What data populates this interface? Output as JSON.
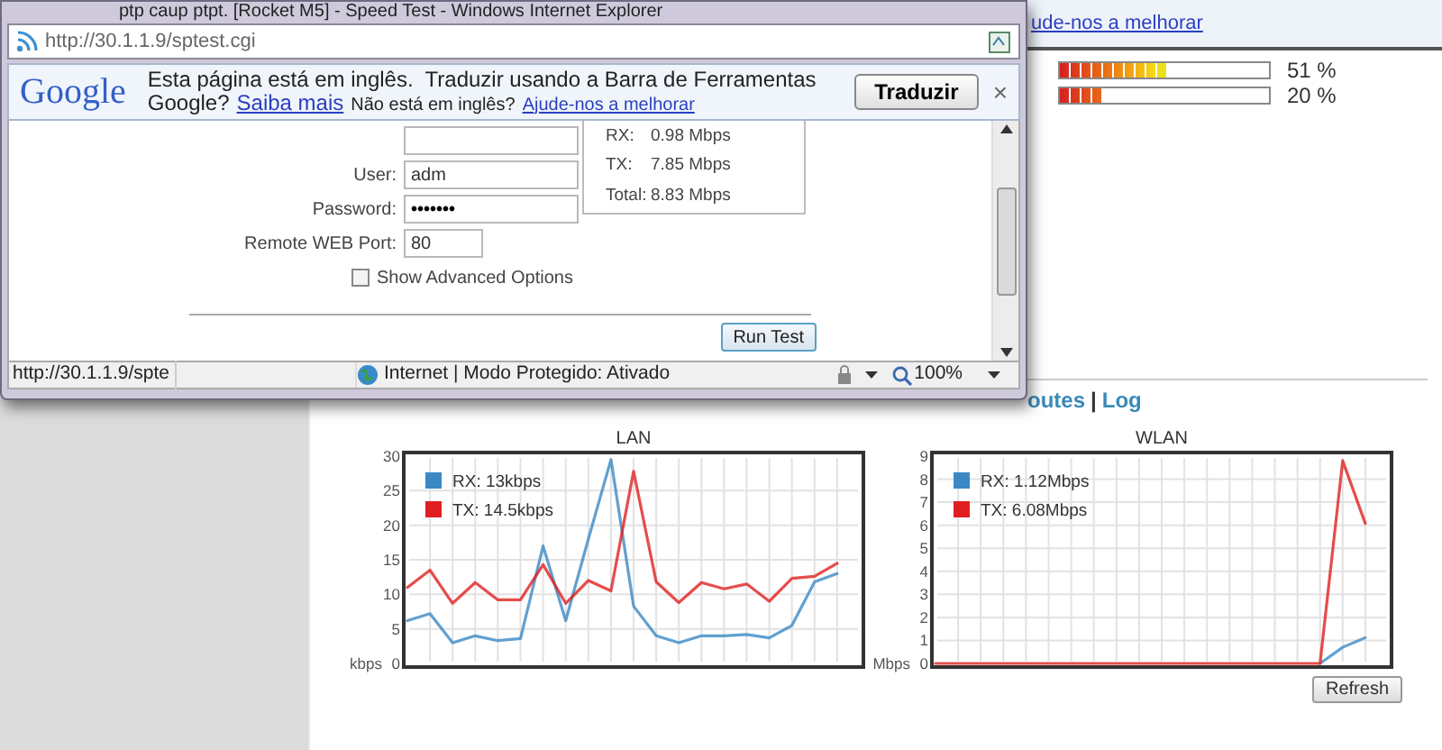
{
  "page": {
    "translate_link": "ude-nos a melhorar",
    "meters": [
      {
        "level": 0.51,
        "reading": "51 %"
      },
      {
        "level": 0.2,
        "reading": "20 %"
      }
    ],
    "links": [
      "outes",
      "Log"
    ],
    "link_separator": "|",
    "charts": [
      {
        "chart_data": {
          "type": "line",
          "title": "LAN",
          "ylabel": "kbps",
          "ylim": [
            0,
            30
          ],
          "yticks": [
            0,
            5,
            10,
            15,
            20,
            25,
            30
          ],
          "grid": true,
          "legend": true,
          "series": [
            {
              "name": "RX: 13kbps",
              "color": "#3b88c4",
              "values": [
                6.2,
                7.2,
                3,
                4,
                3.3,
                3.6,
                17,
                6.2,
                18,
                29.5,
                8.3,
                4,
                3,
                4,
                4,
                4.2,
                3.7,
                5.5,
                11.8,
                13
              ]
            },
            {
              "name": "TX: 14.5kbps",
              "color": "#e02020",
              "values": [
                11,
                13.5,
                8.7,
                11.7,
                9.2,
                9.2,
                14.3,
                8.7,
                12,
                10.5,
                27.8,
                11.8,
                8.8,
                11.7,
                10.8,
                11.5,
                9,
                12.3,
                12.6,
                14.5
              ]
            }
          ]
        }
      },
      {
        "chart_data": {
          "type": "line",
          "title": "WLAN",
          "ylabel": "Mbps",
          "ylim": [
            0,
            9
          ],
          "yticks": [
            0,
            1,
            2,
            3,
            4,
            5,
            6,
            7,
            8,
            9
          ],
          "grid": true,
          "legend": true,
          "series": [
            {
              "name": "RX: 1.12Mbps",
              "color": "#3b88c4",
              "values": [
                null,
                null,
                null,
                null,
                null,
                null,
                null,
                null,
                null,
                null,
                null,
                null,
                null,
                null,
                null,
                null,
                null,
                0,
                0.7,
                1.12
              ]
            },
            {
              "name": "TX: 6.08Mbps",
              "color": "#e02020",
              "values": [
                0,
                0,
                0,
                0,
                0,
                0,
                0,
                0,
                0,
                0,
                0,
                0,
                0,
                0,
                0,
                0,
                0,
                0,
                8.8,
                6.08
              ]
            }
          ]
        }
      }
    ],
    "refresh_button": "Refresh"
  },
  "browser_window": {
    "title": "ptp caup ptpt. [Rocket M5] - Speed Test - Windows Internet Explorer",
    "address": "http://30.1.1.9/sptest.cgi",
    "translate_bar": {
      "logo": "Google",
      "message": "Esta página está em inglês.  Traduzir usando a Barra de Ferramentas",
      "message_end": "Google?",
      "learn_more": "Saiba mais",
      "not_english": "Não está em inglês?",
      "help_link": "Ajude-nos a melhorar",
      "translate_button": "Traduzir",
      "close": "×"
    },
    "fields": [
      {
        "kind": "text"
      },
      {
        "kind": "text",
        "label": "User:",
        "value": "adm"
      },
      {
        "kind": "password",
        "label": "Password:",
        "value": "•••••••"
      },
      {
        "kind": "short",
        "label": "Remote WEB Port:",
        "value": "80"
      }
    ],
    "checkbox": {
      "label": "Show Advanced Options",
      "checked": false
    },
    "results": [
      {
        "label": "RX:",
        "value": "0.98 Mbps"
      },
      {
        "label": "TX:",
        "value": "7.85 Mbps"
      },
      {
        "label": "Total:",
        "value": "8.83 Mbps"
      }
    ],
    "run_button": "Run Test",
    "status_bar": {
      "url": "http://30.1.1.9/spte",
      "zone": "Internet | Modo Protegido: Ativado",
      "zoom": "100%"
    }
  }
}
